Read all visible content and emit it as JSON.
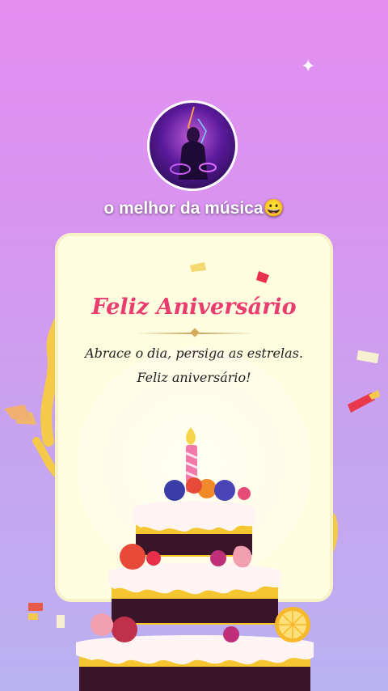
{
  "profile": {
    "username": "o melhor da música😀",
    "avatar_icon": "singer-avatar-icon"
  },
  "card": {
    "title": "Feliz Aniversário",
    "message": "Abrace o dia, persiga as estrelas. Feliz aniversário!"
  },
  "decorations": {
    "sparkle_icon": "sparkle-icon",
    "cake_icon": "birthday-cake-icon",
    "accent_color": "#ea3c6e",
    "card_color": "#fefde0"
  }
}
